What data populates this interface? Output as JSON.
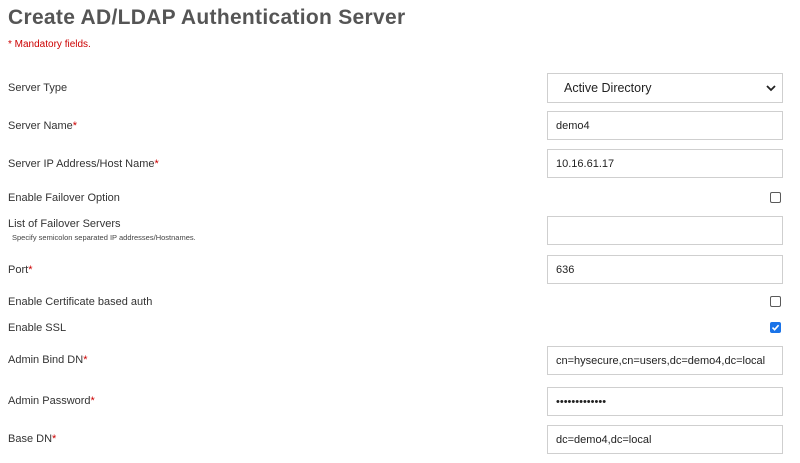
{
  "page": {
    "title": "Create AD/LDAP Authentication Server",
    "mandatory_note": "* Mandatory fields."
  },
  "fields": {
    "server_type": {
      "label": "Server Type",
      "value": "Active Directory"
    },
    "server_name": {
      "label": "Server Name",
      "required_mark": "*",
      "value": "demo4"
    },
    "server_ip": {
      "label": "Server IP Address/Host Name",
      "required_mark": "*",
      "value": "10.16.61.17"
    },
    "enable_failover": {
      "label": "Enable Failover Option",
      "checked": false
    },
    "failover_servers": {
      "label": "List of Failover Servers",
      "hint": "Specify semicolon separated IP addresses/Hostnames.",
      "value": ""
    },
    "port": {
      "label": "Port",
      "required_mark": "*",
      "value": "636"
    },
    "enable_cert_auth": {
      "label": "Enable Certificate based auth",
      "checked": false
    },
    "enable_ssl": {
      "label": "Enable SSL",
      "checked": true
    },
    "admin_bind_dn": {
      "label": "Admin Bind DN",
      "required_mark": "*",
      "value": "cn=hysecure,cn=users,dc=demo4,dc=local"
    },
    "admin_password": {
      "label": "Admin Password",
      "required_mark": "*",
      "value": "•••••••••••••"
    },
    "base_dn": {
      "label": "Base DN",
      "required_mark": "*",
      "value": "dc=demo4,dc=local"
    }
  },
  "icons": {
    "select_chevron": "chevron-down-icon",
    "checkmark": "checkmark-icon"
  },
  "colors": {
    "required": "#cc0000",
    "title": "#555555",
    "checkbox_checked": "#1a73e8"
  }
}
